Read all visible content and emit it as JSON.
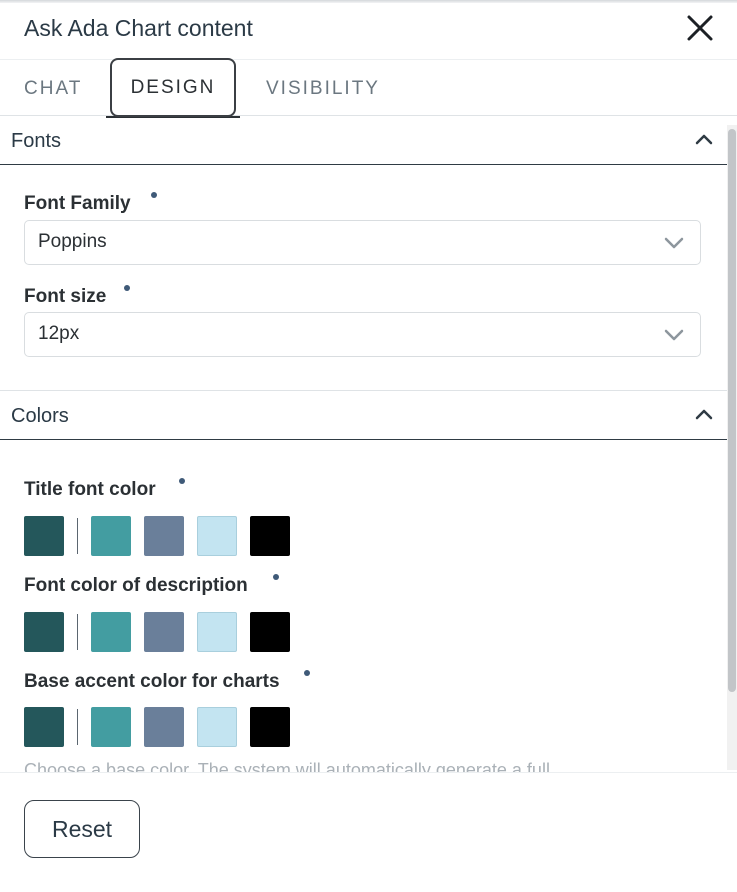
{
  "header": {
    "title": "Ask Ada Chart content",
    "close_icon": "close-icon"
  },
  "tabs": [
    {
      "label": "CHAT",
      "active": false
    },
    {
      "label": "DESIGN",
      "active": true
    },
    {
      "label": "VISIBILITY",
      "active": false
    }
  ],
  "fonts_section": {
    "title": "Fonts",
    "font_family": {
      "label": "Font Family",
      "value": "Poppins"
    },
    "font_size": {
      "label": "Font size",
      "value": "12px"
    }
  },
  "colors_section": {
    "title": "Colors",
    "title_font_color": {
      "label": "Title font color"
    },
    "description_font_color": {
      "label": "Font color of description"
    },
    "base_accent_color": {
      "label": "Base accent color for charts"
    },
    "swatches": [
      "#24575b",
      "#439da1",
      "#6a7f9a",
      "#c3e4f1",
      "#000000"
    ],
    "helper_text": "Choose a base color. The system will automatically generate a full"
  },
  "footer": {
    "reset_label": "Reset"
  },
  "colors": {
    "accent_dot": "#3f5a78",
    "border": "#d9dde0"
  }
}
